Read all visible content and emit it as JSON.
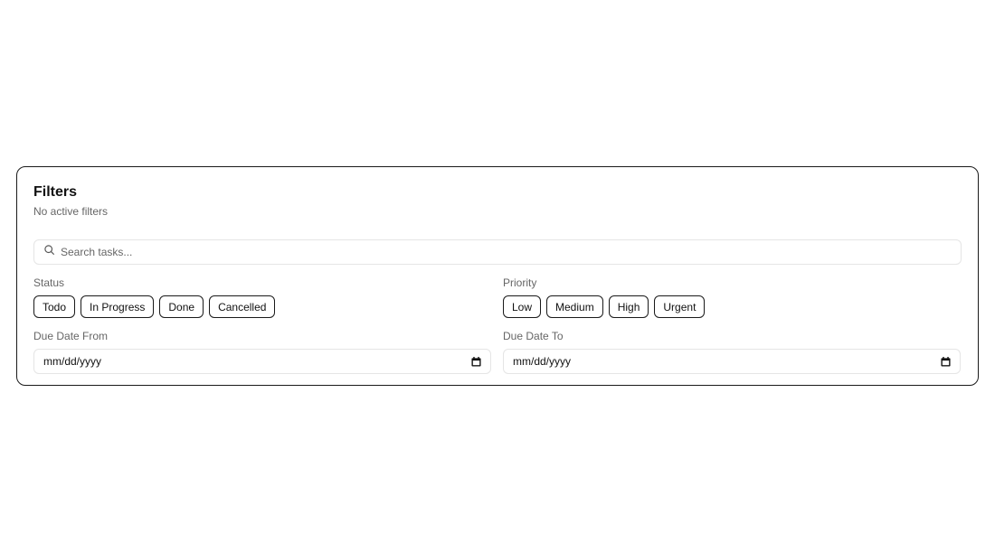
{
  "filters": {
    "title": "Filters",
    "subtitle": "No active filters",
    "search": {
      "placeholder": "Search tasks...",
      "value": "",
      "icon": "search-icon"
    },
    "status": {
      "label": "Status",
      "options": [
        "Todo",
        "In Progress",
        "Done",
        "Cancelled"
      ]
    },
    "priority": {
      "label": "Priority",
      "options": [
        "Low",
        "Medium",
        "High",
        "Urgent"
      ]
    },
    "due_from": {
      "label": "Due Date From",
      "value": "mm/dd/yyyy",
      "icon": "calendar-icon"
    },
    "due_to": {
      "label": "Due Date To",
      "value": "mm/dd/yyyy",
      "icon": "calendar-icon"
    }
  }
}
